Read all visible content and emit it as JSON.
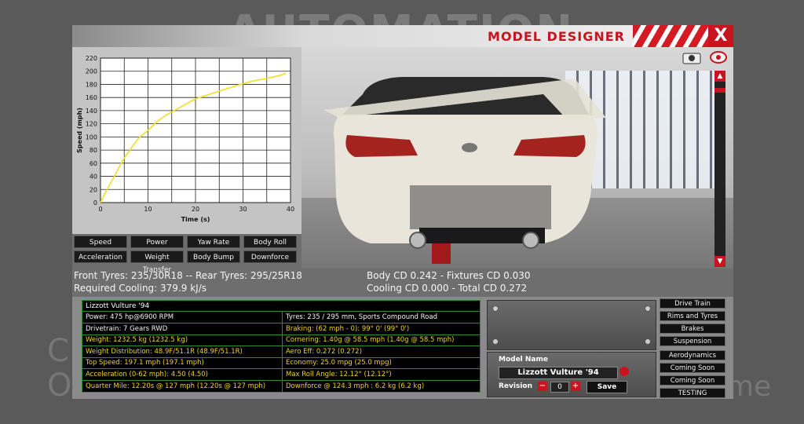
{
  "background": {
    "logo": "AUTOMATION",
    "left_text_1": "C",
    "left_text_2": "O",
    "right_text": "me"
  },
  "window": {
    "title": "MODEL DESIGNER",
    "close_label": "X"
  },
  "chart_data": {
    "type": "line",
    "title": "",
    "xlabel": "Time (s)",
    "ylabel": "Speed (mph)",
    "xlim": [
      0,
      40
    ],
    "ylim": [
      0,
      220
    ],
    "xticks": [
      0,
      10,
      20,
      30,
      40
    ],
    "yticks": [
      0,
      20,
      40,
      60,
      80,
      100,
      120,
      140,
      160,
      180,
      200,
      220
    ],
    "grid": true,
    "series": [
      {
        "x": [
          0,
          1,
          2,
          3,
          4,
          5,
          6,
          7,
          8,
          10,
          12,
          14,
          16,
          18,
          20,
          23,
          26,
          29,
          32,
          35,
          38,
          39
        ],
        "y": [
          0,
          15,
          28,
          41,
          55,
          68,
          78,
          88,
          98,
          110,
          124,
          134,
          142,
          150,
          158,
          165,
          172,
          179,
          185,
          189,
          194,
          197
        ],
        "color": "#f0e020"
      }
    ]
  },
  "graph_buttons": [
    "Speed",
    "Power",
    "Yaw Rate",
    "Body Roll",
    "Acceleration",
    "Weight Transfer",
    "Body Bump",
    "Downforce"
  ],
  "info": {
    "tyres": "Front Tyres: 235/30R18 -- Rear Tyres: 295/25R18",
    "cooling": "Required Cooling: 379.9 kJ/s",
    "cd": "Body CD 0.242 - Fixtures CD 0.030",
    "total_cd": "Cooling CD 0.000 - Total CD 0.272"
  },
  "stats": {
    "header": "Lizzott Vulture '94",
    "left": [
      {
        "text": "Power: 475 hp@6900 RPM",
        "color": "white"
      },
      {
        "text": "Drivetrain: 7 Gears RWD",
        "color": "white"
      },
      {
        "text": "Weight: 1232.5 kg (1232.5 kg)",
        "color": "yellow"
      },
      {
        "text": "Weight Distribution: 48.9F/51.1R (48.9F/51.1R)",
        "color": "yellow"
      },
      {
        "text": "Top Speed: 197.1 mph (197.1 mph)",
        "color": "yellow"
      },
      {
        "text": "Acceleration (0-62 mph): 4.50 (4.50)",
        "color": "yellow"
      },
      {
        "text": "Quarter Mile: 12.20s @ 127 mph (12.20s @ 127 mph)",
        "color": "yellow"
      }
    ],
    "right": [
      {
        "text": "Tyres: 235 / 295 mm, Sports Compound Road",
        "color": "white"
      },
      {
        "text": "Braking: (62 mph - 0): 99° 0' (99° 0')",
        "color": "yellow"
      },
      {
        "text": "Cornering: 1.40g @ 58.5 mph (1.40g @ 58.5 mph)",
        "color": "yellow"
      },
      {
        "text": "Aero Eff: 0.272 (0.272)",
        "color": "yellow"
      },
      {
        "text": "Economy: 25.0 mpg (25.0 mpg)",
        "color": "yellow"
      },
      {
        "text": "Max Roll Angle: 12.12° (12.12°)",
        "color": "yellow"
      },
      {
        "text": "Downforce @ 124.3 mph : 6.2 kg (6.2 kg)",
        "color": "yellow"
      }
    ]
  },
  "model": {
    "label": "Model Name",
    "name": "Lizzott Vulture '94",
    "revision_label": "Revision",
    "revision_value": "0",
    "save_label": "Save",
    "minus": "−",
    "plus": "+"
  },
  "side_buttons": [
    "Drive Train",
    "Rims and Tyres",
    "Brakes",
    "Suspension",
    "Aerodynamics",
    "Coming Soon",
    "Coming Soon",
    "TESTING"
  ],
  "colors": {
    "accent": "#c8141e",
    "line": "#f0e020",
    "stat_yellow": "#f2d21a",
    "table_border": "#2e8b2e"
  }
}
